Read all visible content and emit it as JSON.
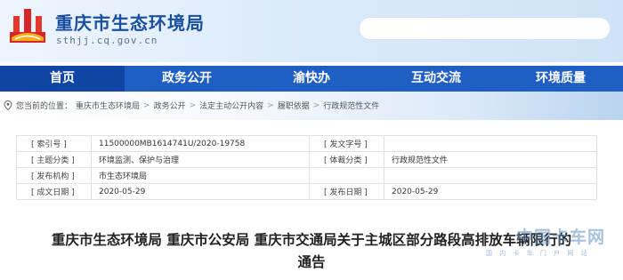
{
  "header": {
    "site_title": "重庆市生态环境局",
    "site_url": "sthjj.cq.gov.cn",
    "search_placeholder": ""
  },
  "nav": {
    "items": [
      {
        "label": "首页",
        "active": true
      },
      {
        "label": "政务公开",
        "active": false
      },
      {
        "label": "渝快办",
        "active": false
      },
      {
        "label": "互动交流",
        "active": false
      },
      {
        "label": "环境质量",
        "active": false
      }
    ]
  },
  "breadcrumb": {
    "prefix": "您当前的位置：",
    "items": [
      "重庆市生态环境局",
      "政务公开",
      "法定主动公开内容",
      "履职依据",
      "行政规范性文件"
    ],
    "separator": ">"
  },
  "meta": {
    "index_no_key": "[ 索引号 ]",
    "index_no_val": "11500000MB1614741U/2020-19758",
    "doc_no_key": "[ 发文字号 ]",
    "doc_no_val": "",
    "topic_key": "[ 主题分类 ]",
    "topic_val": "环境监测、保护与治理",
    "genre_key": "[ 体裁分类 ]",
    "genre_val": "行政规范性文件",
    "issuer_key": "[ 发布机构 ]",
    "issuer_val": "市生态环境局",
    "created_key": "[ 成文日期 ]",
    "created_val": "2020-05-29",
    "published_key": "[ 发布日期 ]",
    "published_val": "2020-05-29"
  },
  "article": {
    "title_line1": "重庆市生态环境局 重庆市公安局 重庆市交通局关于主城区部分路段高排放车辆限行的",
    "title_line2": "通告"
  },
  "watermark": {
    "text": "中国卡车网",
    "sub": "国 内 卡 车 门 户 网 站"
  },
  "colors": {
    "nav_bg": "#1f5fc4",
    "nav_active": "#0f46a3",
    "title_blue": "#1a4fa0"
  }
}
